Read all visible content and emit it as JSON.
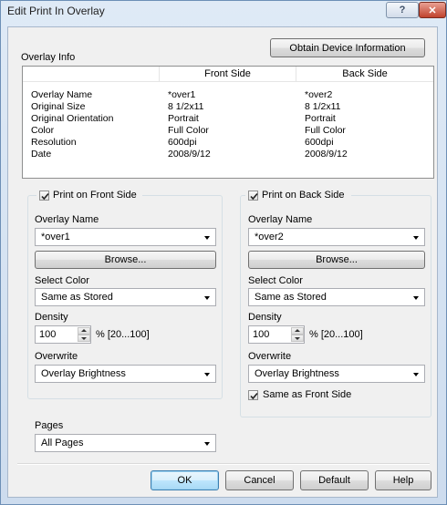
{
  "window": {
    "title": "Edit Print In Overlay",
    "help_glyph": "?",
    "close_glyph": "✕"
  },
  "overlay_info": {
    "label": "Overlay Info",
    "obtain_button": "Obtain Device Information",
    "columns": [
      "",
      "Front Side",
      "Back Side"
    ],
    "rows": [
      {
        "name": "Overlay Name",
        "front": "*over1",
        "back": "*over2"
      },
      {
        "name": "Original Size",
        "front": "8 1/2x11",
        "back": "8 1/2x11"
      },
      {
        "name": "Original Orientation",
        "front": "Portrait",
        "back": "Portrait"
      },
      {
        "name": "Color",
        "front": "Full Color",
        "back": "Full Color"
      },
      {
        "name": "Resolution",
        "front": "600dpi",
        "back": "600dpi"
      },
      {
        "name": "Date",
        "front": "2008/9/12",
        "back": "2008/9/12"
      }
    ]
  },
  "front": {
    "checkbox_label": "Print on Front Side",
    "checked": true,
    "overlay_name_label": "Overlay Name",
    "overlay_name_value": "*over1",
    "browse": "Browse...",
    "select_color_label": "Select Color",
    "select_color_value": "Same as Stored",
    "density_label": "Density",
    "density_value": "100",
    "density_range": "% [20...100]",
    "overwrite_label": "Overwrite",
    "overwrite_value": "Overlay Brightness"
  },
  "back": {
    "checkbox_label": "Print on Back Side",
    "checked": true,
    "overlay_name_label": "Overlay Name",
    "overlay_name_value": "*over2",
    "browse": "Browse...",
    "select_color_label": "Select Color",
    "select_color_value": "Same as Stored",
    "density_label": "Density",
    "density_value": "100",
    "density_range": "% [20...100]",
    "overwrite_label": "Overwrite",
    "overwrite_value": "Overlay Brightness",
    "same_as_front_label": "Same as Front Side",
    "same_as_front_checked": true
  },
  "pages": {
    "label": "Pages",
    "value": "All Pages"
  },
  "footer": {
    "ok": "OK",
    "cancel": "Cancel",
    "default": "Default",
    "help": "Help"
  }
}
